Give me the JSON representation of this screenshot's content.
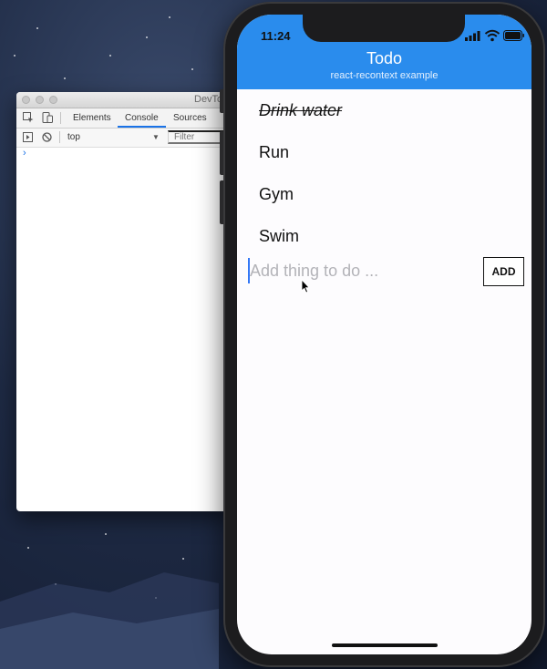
{
  "devtools": {
    "window_title": "DevTo",
    "tabs": [
      {
        "label": "Elements"
      },
      {
        "label": "Console"
      },
      {
        "label": "Sources"
      }
    ],
    "active_tab": "Console",
    "context_select": "top",
    "filter_placeholder": "Filter",
    "prompt_symbol": "›",
    "icons": [
      "inspect-element-icon",
      "device-toolbar-icon",
      "console-sidebar-icon",
      "clear-console-icon"
    ]
  },
  "phone": {
    "status_time": "11:24",
    "header_color": "#2a8ced",
    "status_icons": [
      "signal-icon",
      "wifi-icon",
      "battery-icon"
    ]
  },
  "app": {
    "title": "Todo",
    "subtitle": "react-recontext example",
    "todos": [
      {
        "label": "Drink water",
        "completed": true
      },
      {
        "label": "Run",
        "completed": false
      },
      {
        "label": "Gym",
        "completed": false
      },
      {
        "label": "Swim",
        "completed": false
      }
    ],
    "input": {
      "value": "",
      "placeholder": "Add thing to do ..."
    },
    "add_button_label": "ADD"
  }
}
